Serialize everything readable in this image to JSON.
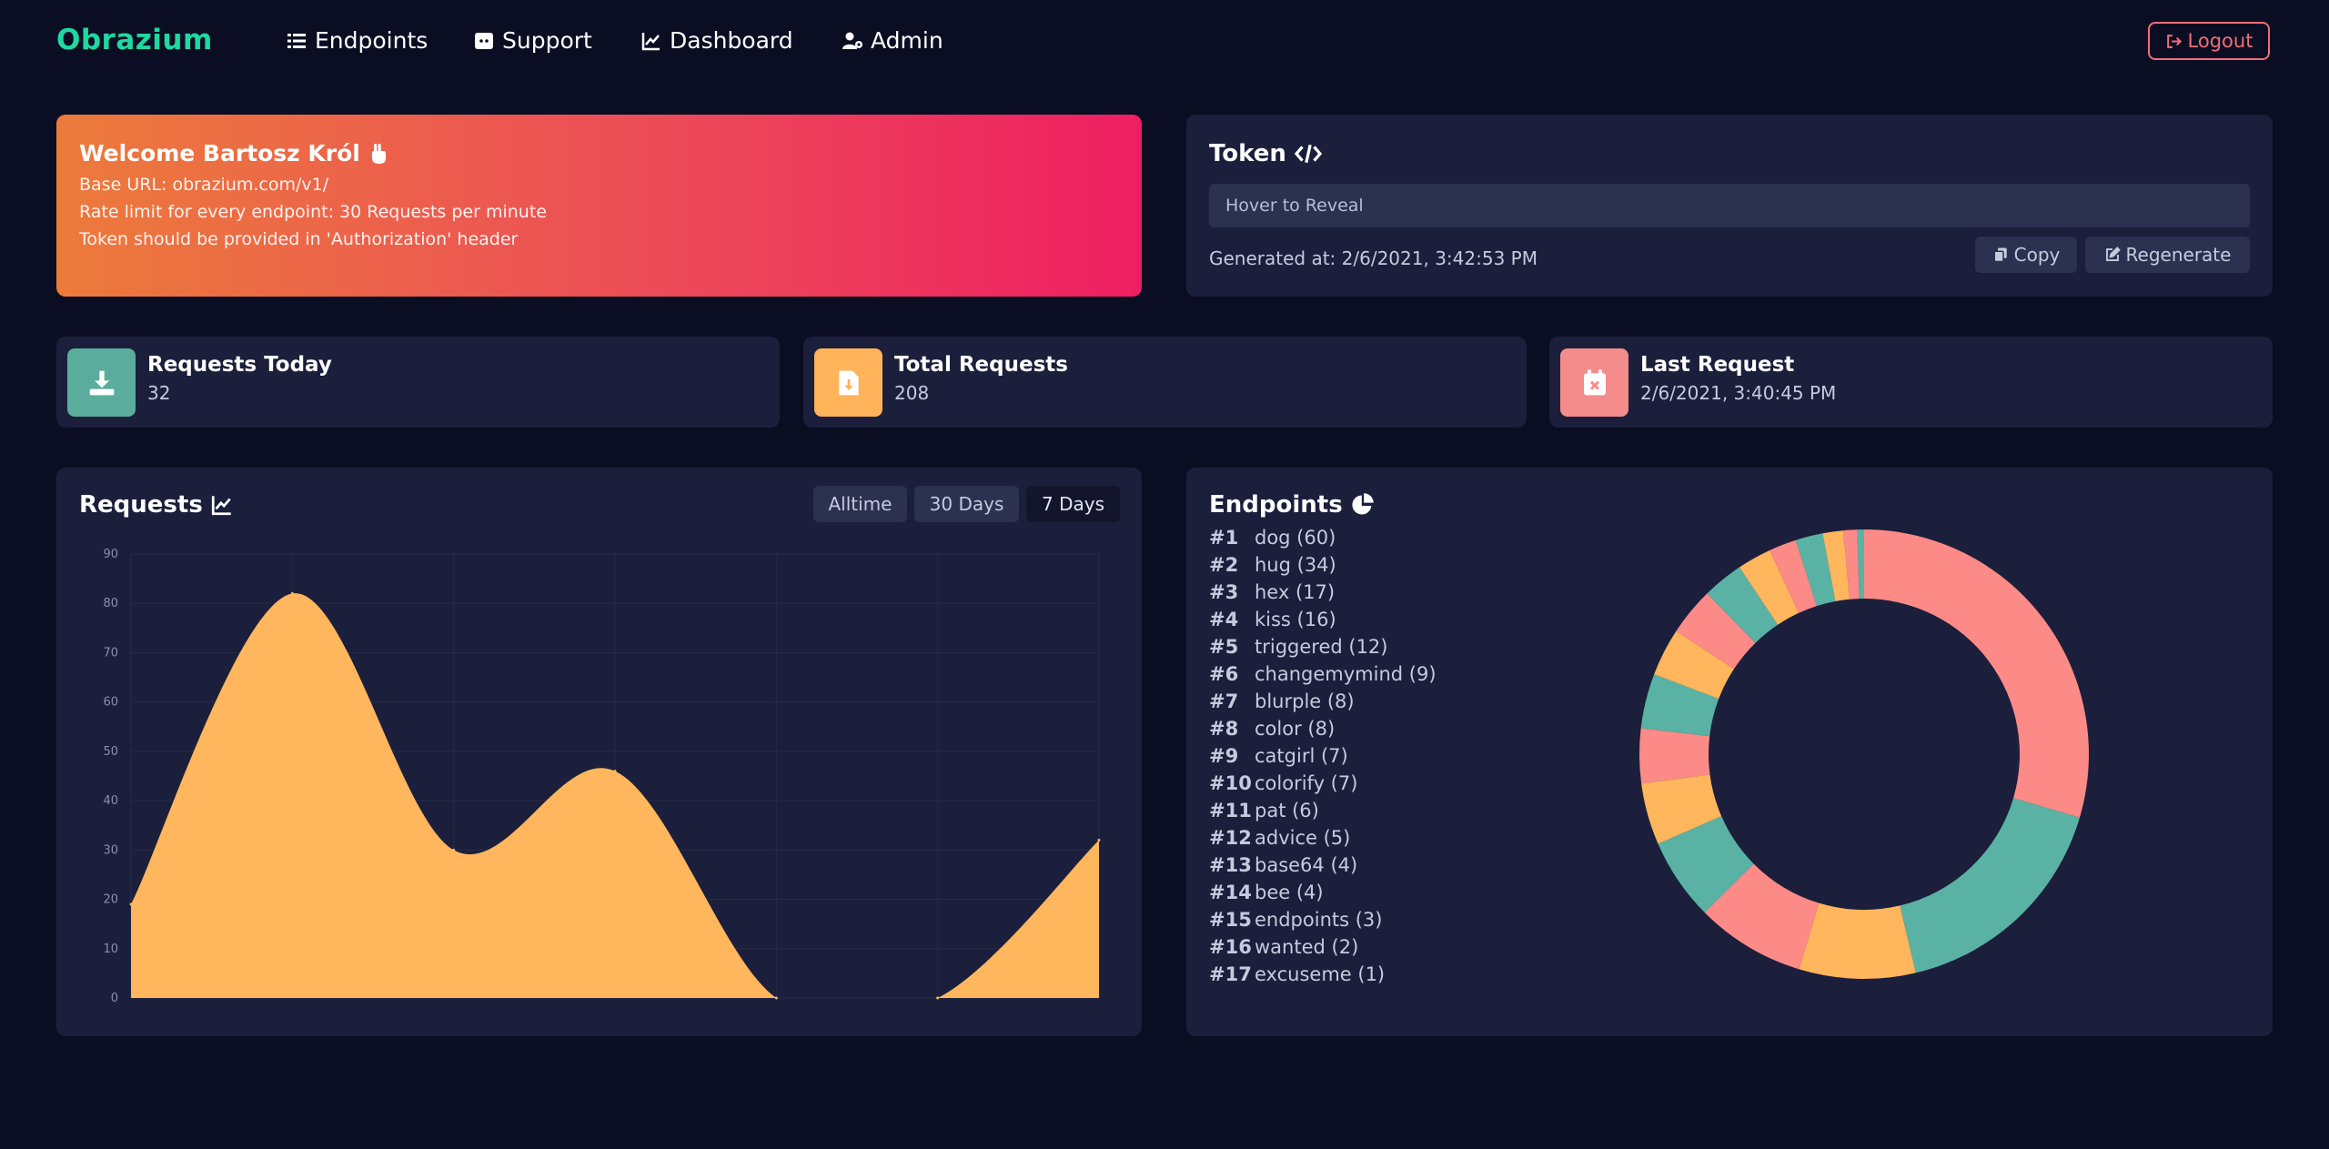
{
  "nav": {
    "brand": "Obrazium",
    "links": [
      {
        "label": "Endpoints",
        "icon": "list-icon"
      },
      {
        "label": "Support",
        "icon": "discord-icon"
      },
      {
        "label": "Dashboard",
        "icon": "chart-line-icon"
      },
      {
        "label": "Admin",
        "icon": "user-cog-icon"
      }
    ],
    "logout_label": "Logout"
  },
  "welcome": {
    "title": "Welcome Bartosz Król",
    "lines": [
      "Base URL: obrazium.com/v1/",
      "Rate limit for every endpoint: 30 Requests per minute",
      "Token should be provided in 'Authorization' header"
    ]
  },
  "token": {
    "title": "Token",
    "reveal_placeholder": "Hover to Reveal",
    "generated": "Generated at: 2/6/2021, 3:42:53 PM",
    "copy_label": "Copy",
    "regenerate_label": "Regenerate"
  },
  "stats": [
    {
      "label": "Requests Today",
      "value": "32",
      "color": "#5aad9c",
      "icon": "download-icon"
    },
    {
      "label": "Total Requests",
      "value": "208",
      "color": "#ffb35a",
      "icon": "file-download-icon"
    },
    {
      "label": "Last Request",
      "value": "2/6/2021, 3:40:45 PM",
      "color": "#f58c8c",
      "icon": "calendar-times-icon"
    }
  ],
  "requests": {
    "title": "Requests",
    "ranges": [
      "Alltime",
      "30 Days",
      "7 Days"
    ],
    "active_range": "7 Days"
  },
  "endpoints": {
    "title": "Endpoints",
    "items": [
      {
        "rank": "#1",
        "label": "dog (60)"
      },
      {
        "rank": "#2",
        "label": "hug (34)"
      },
      {
        "rank": "#3",
        "label": "hex (17)"
      },
      {
        "rank": "#4",
        "label": "kiss (16)"
      },
      {
        "rank": "#5",
        "label": "triggered (12)"
      },
      {
        "rank": "#6",
        "label": "changemymind (9)"
      },
      {
        "rank": "#7",
        "label": "blurple (8)"
      },
      {
        "rank": "#8",
        "label": "color (8)"
      },
      {
        "rank": "#9",
        "label": "catgirl (7)"
      },
      {
        "rank": "#10",
        "label": "colorify (7)"
      },
      {
        "rank": "#11",
        "label": "pat (6)"
      },
      {
        "rank": "#12",
        "label": "advice (5)"
      },
      {
        "rank": "#13",
        "label": "base64 (4)"
      },
      {
        "rank": "#14",
        "label": "bee (4)"
      },
      {
        "rank": "#15",
        "label": "endpoints (3)"
      },
      {
        "rank": "#16",
        "label": "wanted (2)"
      },
      {
        "rank": "#17",
        "label": "excuseme (1)"
      }
    ]
  },
  "chart_data": [
    {
      "type": "area",
      "title": "Requests",
      "x": [
        0,
        1,
        2,
        3,
        4,
        5,
        6
      ],
      "series": [
        {
          "values": [
            19,
            82,
            30,
            46,
            0,
            0,
            32
          ]
        }
      ],
      "ylim": [
        0,
        90
      ],
      "yticks": [
        0,
        10,
        20,
        30,
        40,
        50,
        60,
        70,
        80,
        90
      ],
      "grid": true,
      "color": "#ffb65c"
    },
    {
      "type": "pie",
      "title": "Endpoints",
      "categories": [
        "dog",
        "hug",
        "hex",
        "kiss",
        "triggered",
        "changemymind",
        "blurple",
        "color",
        "catgirl",
        "colorify",
        "pat",
        "advice",
        "base64",
        "bee",
        "endpoints",
        "wanted",
        "excuseme"
      ],
      "values": [
        60,
        34,
        17,
        16,
        12,
        9,
        8,
        8,
        7,
        7,
        6,
        5,
        4,
        4,
        3,
        2,
        1
      ],
      "colors": [
        "#fc8a87",
        "#5ab2a4",
        "#ffb65c"
      ]
    }
  ]
}
